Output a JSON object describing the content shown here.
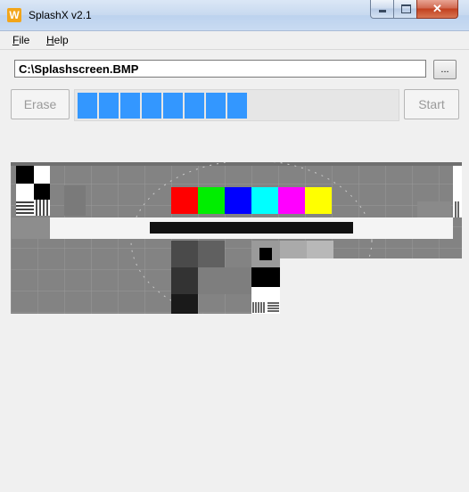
{
  "window": {
    "title": "SplashX v2.1",
    "app_icon": "splashx-app-icon"
  },
  "title_controls": {
    "minimize_icon": "minimize-icon",
    "maximize_icon": "maximize-icon",
    "close_icon": "close-icon"
  },
  "menu": {
    "items": [
      {
        "label": "File",
        "access_key": "F"
      },
      {
        "label": "Help",
        "access_key": "H"
      }
    ]
  },
  "file_path": {
    "value": "C:\\Splashscreen.BMP"
  },
  "browse_button": {
    "label": "..."
  },
  "erase_button": {
    "label": "Erase",
    "enabled": false
  },
  "start_button": {
    "label": "Start",
    "enabled": false
  },
  "progress": {
    "fraction": 0.53,
    "segments_filled": 8,
    "color": "#3397ff"
  },
  "preview": {
    "description_icon": "test-pattern-image",
    "color_bars": [
      "#ff0000",
      "#00ee00",
      "#0000ff",
      "#00ffff",
      "#ff00ff",
      "#ffff00"
    ]
  }
}
